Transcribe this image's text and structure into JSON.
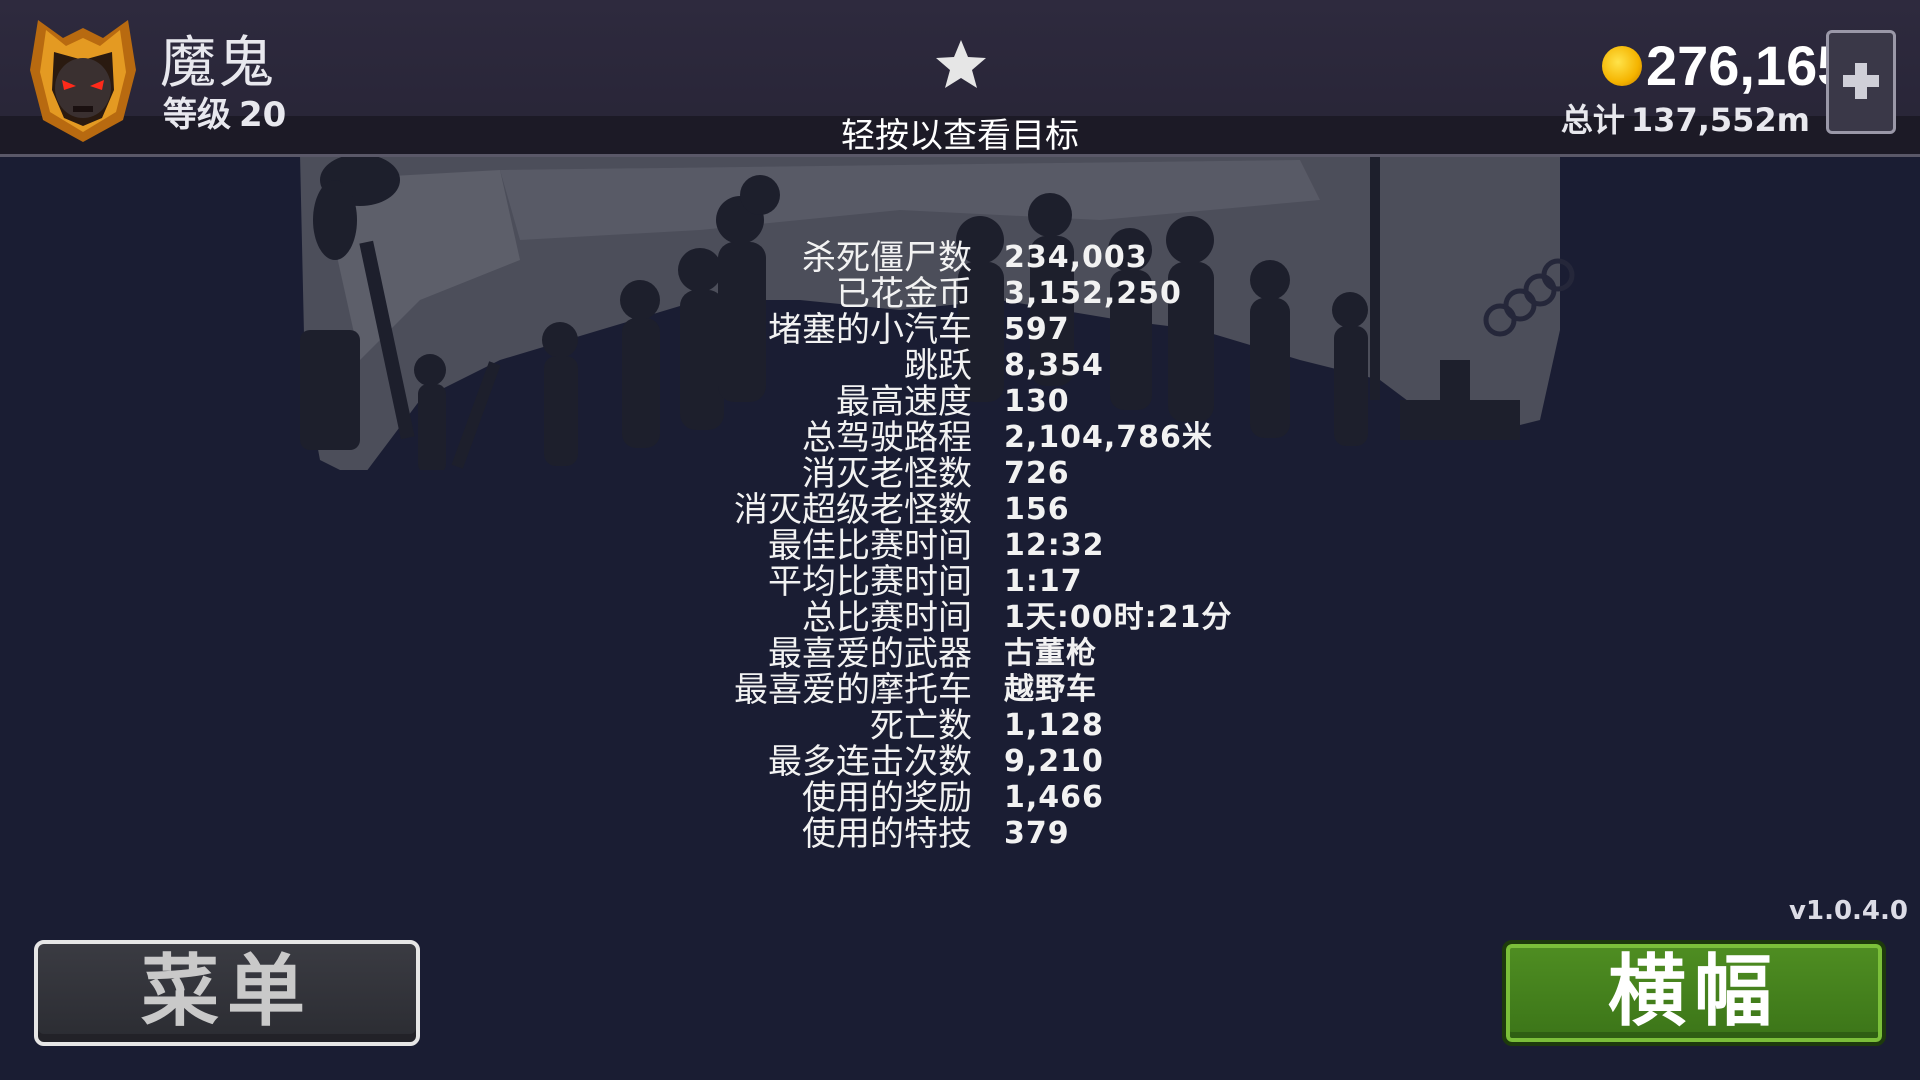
{
  "player": {
    "name": "魔鬼",
    "level_label": "等级",
    "level": "20"
  },
  "header": {
    "tap_hint": "轻按以查看目标",
    "coins": "276,165",
    "total_label": "总计",
    "total_distance": "137,552m"
  },
  "stats": [
    {
      "label": "杀死僵尸数",
      "value": "234,003"
    },
    {
      "label": "已花金币",
      "value": "3,152,250"
    },
    {
      "label": "堵塞的小汽车",
      "value": "597"
    },
    {
      "label": "跳跃",
      "value": "8,354"
    },
    {
      "label": "最高速度",
      "value": "130"
    },
    {
      "label": "总驾驶路程",
      "value": "2,104,786米"
    },
    {
      "label": "消灭老怪数",
      "value": "726"
    },
    {
      "label": "消灭超级老怪数",
      "value": "156"
    },
    {
      "label": "最佳比赛时间",
      "value": "12:32"
    },
    {
      "label": "平均比赛时间",
      "value": "1:17"
    },
    {
      "label": "总比赛时间",
      "value": "1天:00时:21分"
    },
    {
      "label": "最喜爱的武器",
      "value": "古董枪"
    },
    {
      "label": "最喜爱的摩托车",
      "value": "越野车"
    },
    {
      "label": "死亡数",
      "value": "1,128"
    },
    {
      "label": "最多连击次数",
      "value": "9,210"
    },
    {
      "label": "使用的奖励",
      "value": "1,466"
    },
    {
      "label": "使用的特技",
      "value": "379"
    }
  ],
  "version": "v1.0.4.0",
  "buttons": {
    "menu": "菜单",
    "banner": "横幅"
  },
  "icons": {
    "avatar": "demon-avatar-icon",
    "star": "star-icon",
    "coin": "coin-icon",
    "plus": "plus-icon"
  },
  "colors": {
    "background": "#1a1d33",
    "banner_button": "#4f8e22",
    "menu_button": "#35363c"
  }
}
